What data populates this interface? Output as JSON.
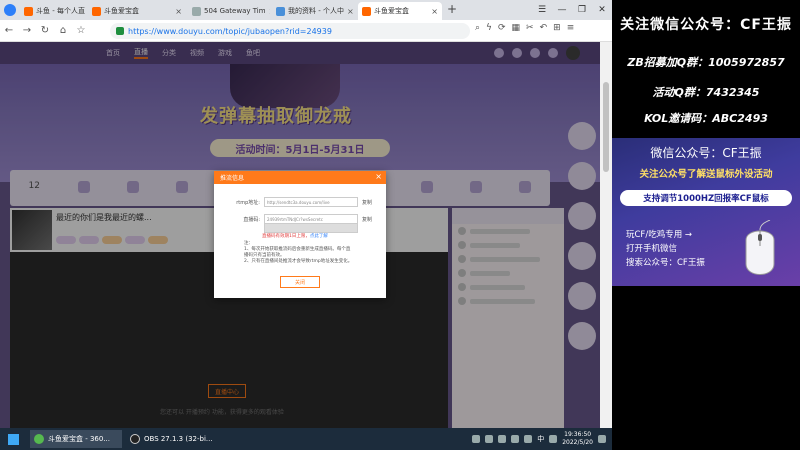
{
  "browser": {
    "tabs": [
      {
        "label": "斗鱼 - 每个人直",
        "active": false
      },
      {
        "label": "斗鱼爱宝盒",
        "active": false
      },
      {
        "label": "504 Gateway Tim",
        "active": false
      },
      {
        "label": "我的资料 - 个人中",
        "active": false
      },
      {
        "label": "斗鱼爱宝盒",
        "active": true
      }
    ],
    "new_tab": "+",
    "url": "https://www.douyu.com/topic/jubaopen?rid=24939",
    "window_controls": [
      "minimize",
      "restore",
      "close"
    ]
  },
  "site": {
    "nav": [
      "首页",
      "直播",
      "分类",
      "视频",
      "游戏",
      "鱼吧"
    ],
    "banner_title": "发弹幕抽取御龙戒",
    "banner_time": "活动时间：5月1日-5月31日",
    "strip_count": "12",
    "room_title": "最近的你们是我最近的螺...",
    "video_button": "直播中心",
    "video_note": "您还可以 开播预约 功能，获得更多的观看体验"
  },
  "modal": {
    "title": "推流信息",
    "close": "×",
    "rtmp_label": "rtmp地址:",
    "rtmp_value": "http://sendtc3a.douyu.com/live",
    "key_label": "直播码:",
    "key_value": "24939rtmTNdJCr?wsSecretc",
    "copy_label": "复制",
    "warning": "直播码有效期1日上限，",
    "warning_link": "点此了解",
    "notes_head": "注：",
    "note1": "1、每次开始获取推流码后会重新生成直播码。每个直",
    "note1b": "播码只有当前有效。",
    "note2": "2、只有在直播间处推流才会导致rtmp地址发生变化。",
    "button": "关闭"
  },
  "taskbar": {
    "apps": [
      {
        "label": "斗鱼爱宝盒 - 360...",
        "active": true
      },
      {
        "label": "OBS 27.1.3 (32-bi...",
        "active": false
      }
    ],
    "ime": "中",
    "time": "19:36:50",
    "date": "2022/5/20"
  },
  "overlay": {
    "title": "关注微信公众号：CF王振",
    "line_group": "ZB招募加Q群：1005972857",
    "line_qq": "活动Q群：7432345",
    "line_kol": "KOL邀请码：ABC2493",
    "promo_title": "微信公众号：CF王振",
    "promo_sub": "关注公众号了解送鼠标外设活动",
    "promo_bar": "支持调节1000HZ回报率CF鼠标",
    "promo_l1": "玩CF/吃鸡专用 →",
    "promo_l2": "打开手机微信",
    "promo_l3": "搜索公众号：CF王振"
  }
}
